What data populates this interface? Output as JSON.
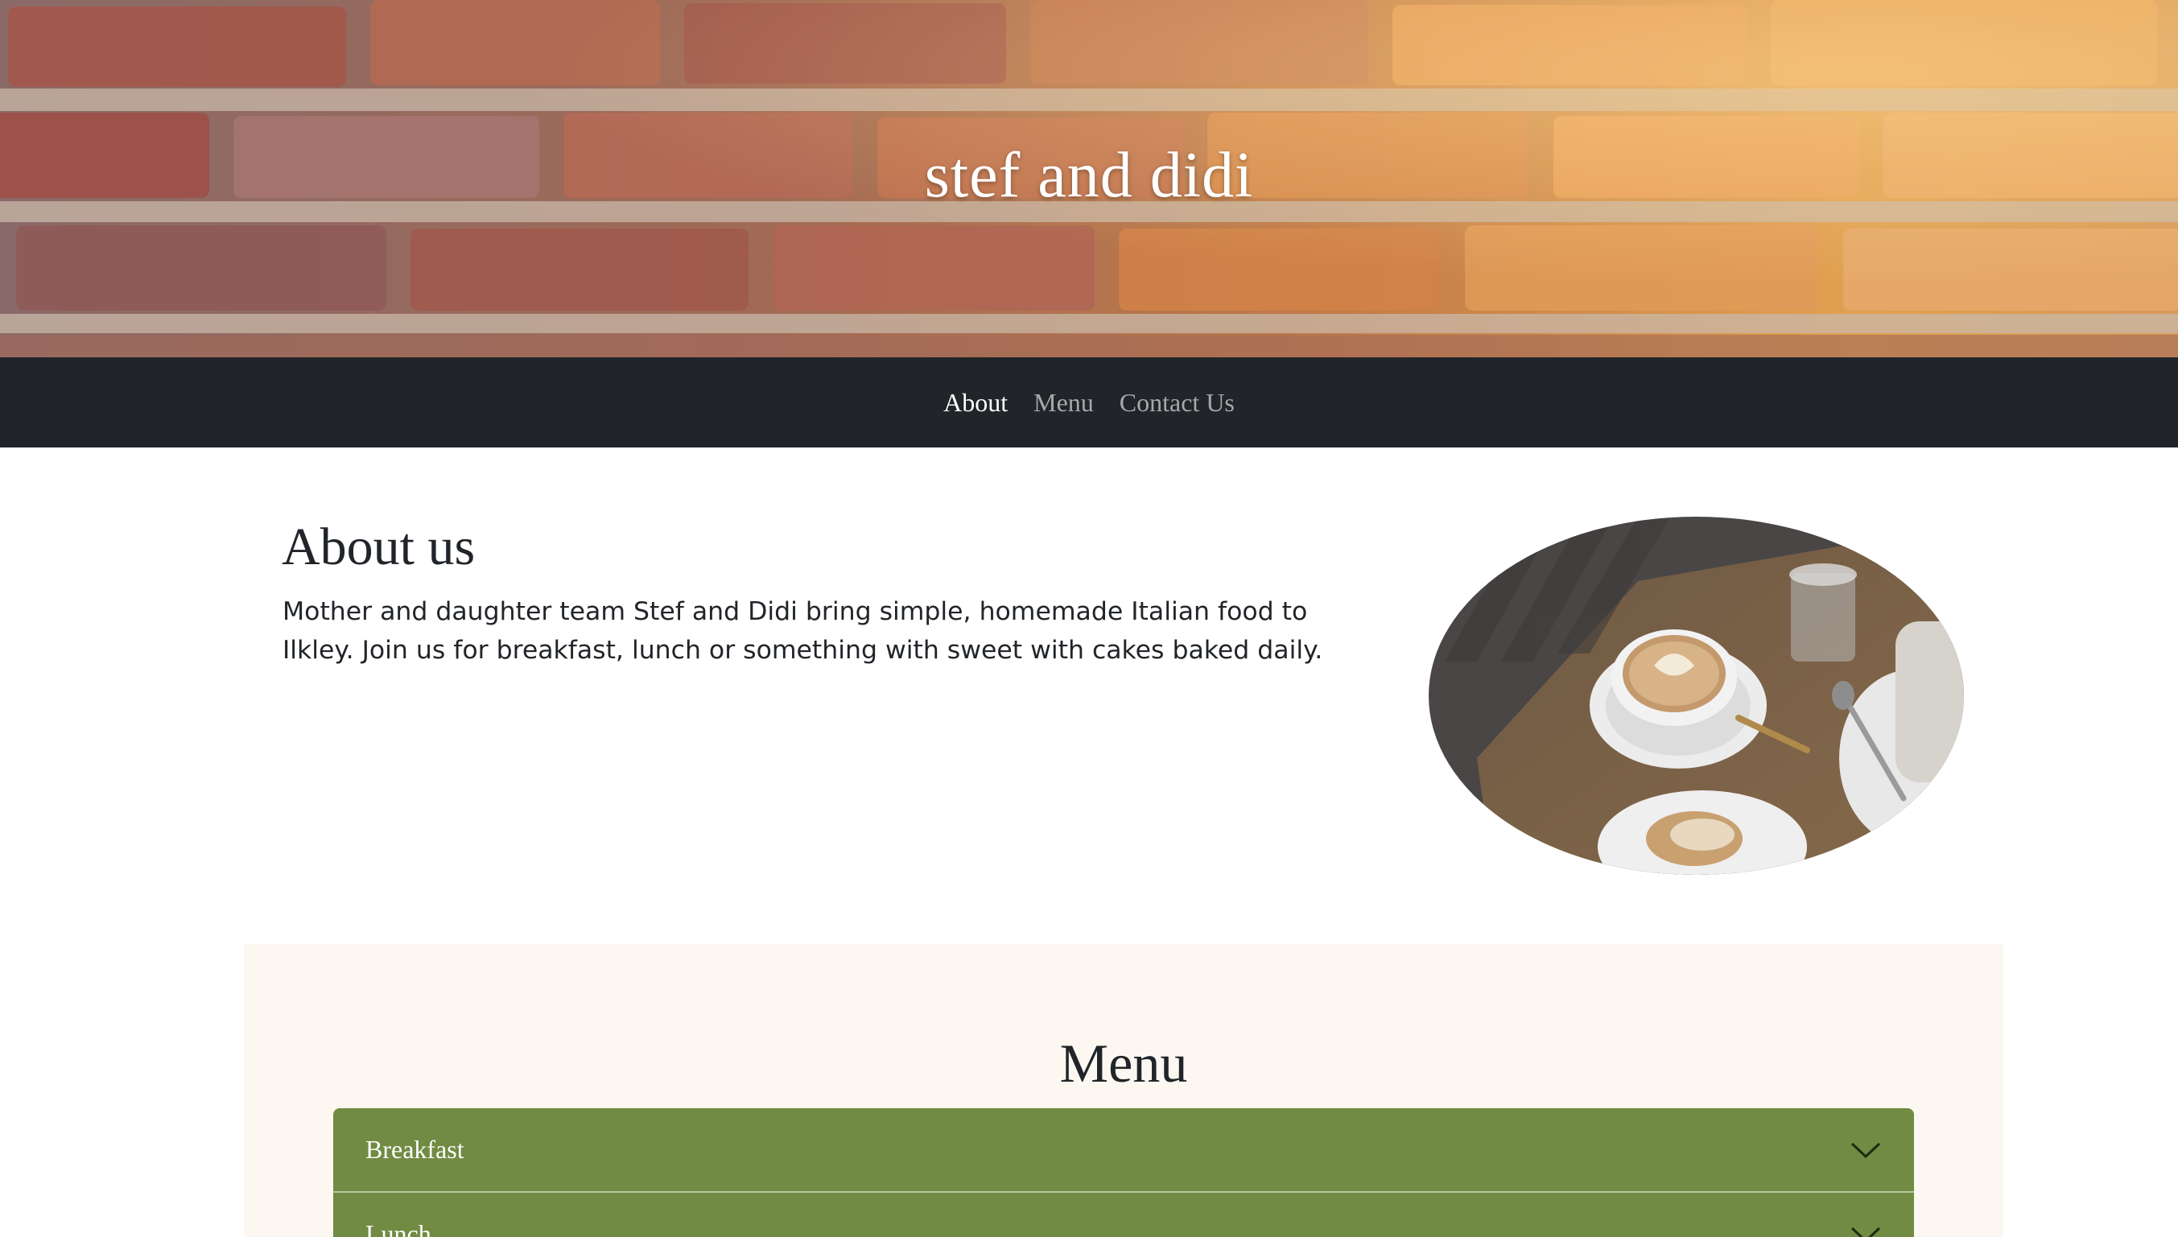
{
  "site": {
    "title": "stef and didi"
  },
  "nav": {
    "items": [
      {
        "label": "About",
        "active": true
      },
      {
        "label": "Menu",
        "active": false
      },
      {
        "label": "Contact Us",
        "active": false
      }
    ]
  },
  "about": {
    "heading": "About us",
    "text": "Mother and daughter team Stef and Didi bring simple, homemade Italian food to Ilkley. Join us for breakfast, lunch or something with sweet with cakes baked daily."
  },
  "menu": {
    "heading": "Menu",
    "sections": [
      {
        "label": "Breakfast"
      },
      {
        "label": "Lunch"
      }
    ]
  },
  "colors": {
    "nav_background": "#212529",
    "accordion_green": "#718b43",
    "menu_background": "#fcf8f1",
    "text_dark": "#212529"
  }
}
